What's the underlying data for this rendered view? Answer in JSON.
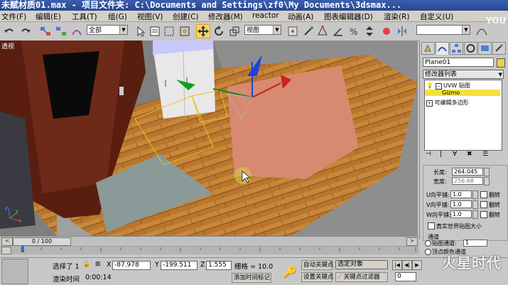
{
  "window": {
    "title": "未赋材质01.max    - 项目文件夹: C:\\Documents and Settings\\zf0\\My Documents\\3dsmax..."
  },
  "menu": {
    "items": [
      "文件(F)",
      "编辑(E)",
      "工具(T)",
      "组(G)",
      "视图(V)",
      "创建(C)",
      "修改器(M)",
      "reactor",
      "动画(A)",
      "图表编辑器(D)",
      "渲染(R)",
      "自定义(U)"
    ]
  },
  "toolbar": {
    "selection_filter": "全部",
    "reference_coord": "视图"
  },
  "viewport": {
    "label": "透视",
    "axis_labels": [
      "x",
      "y",
      "z"
    ]
  },
  "command_panel": {
    "object_name": "Plane01",
    "modifier_list": "修改器列表",
    "stack": [
      "UVW 贴图",
      "Gizmo",
      "可编辑多边形"
    ],
    "params": {
      "length_label": "长度:",
      "length_value": "264.045",
      "width_label": "宽度:",
      "width_value": "256.68",
      "u_tile_label": "U向平铺:",
      "u_tile_value": "1.0",
      "v_tile_label": "V向平铺:",
      "v_tile_value": "1.0",
      "w_tile_label": "W向平铺:",
      "w_tile_value": "1.0",
      "flip_label": "翻转",
      "real_world_label": "真实世界贴图大小",
      "channel_group": "通道",
      "map_channel_label": "贴图通道:",
      "map_channel_value": "1",
      "vertex_color_label": "顶点颜色通道"
    }
  },
  "timeline": {
    "frame_display": "0 / 100"
  },
  "status": {
    "selection": "选择了 1",
    "x_label": "X",
    "x_value": "-87.978",
    "y_label": "Y",
    "y_value": "-199.511",
    "z_label": "Z",
    "z_value": "1.555",
    "grid": "栅格 = 10.0",
    "render_time_label": "渲染时间",
    "render_time": "0:00:14",
    "add_time_tag": "添加时间标记",
    "auto_key": "自动关键点",
    "selected_object": "选定对象",
    "set_key": "设置关键点",
    "key_filter": "关键点过滤器",
    "frame_number": "0"
  },
  "watermark": {
    "top": "YOU",
    "bottom": "火星时代"
  },
  "colors": {
    "title_bar": "#2a4690",
    "active_tool": "#f2d56a",
    "gizmo_yellow": "#e8c020"
  }
}
